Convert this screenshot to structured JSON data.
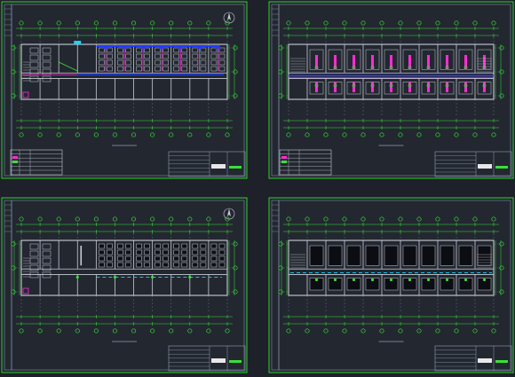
{
  "app": {
    "title": ""
  },
  "colors": {
    "background": "#1e2129",
    "sheet_fill": "#232730",
    "frame": "#2bd22b",
    "grid_line": "#39e039",
    "wall": "#c8ccd6",
    "dim": "#8fa0b8",
    "magenta": "#ff2bd6",
    "blue": "#1f3cff",
    "cyan": "#19d6ff",
    "white": "#e8e8e8"
  },
  "sheets": [
    {
      "id": "sheet-1",
      "label": "",
      "variant": "furnished-west"
    },
    {
      "id": "sheet-2",
      "label": "",
      "variant": "mirror-rooms"
    },
    {
      "id": "sheet-3",
      "label": "",
      "variant": "furnished-dark"
    },
    {
      "id": "sheet-4",
      "label": "",
      "variant": "blocks-dark"
    }
  ],
  "icons": {
    "north_arrow": "north-arrow-icon"
  }
}
